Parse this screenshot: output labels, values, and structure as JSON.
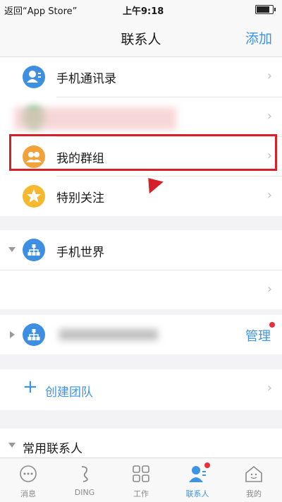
{
  "status_bar": {
    "back_label": "返回“App Store”",
    "time": "上午9:18"
  },
  "header": {
    "title": "联系人",
    "add_label": "添加"
  },
  "contacts": {
    "items": [
      {
        "label": "手机通讯录",
        "icon": "person-book-icon"
      },
      {
        "label": "",
        "icon": "blurred-icon"
      },
      {
        "label": "我的群组",
        "icon": "group-icon"
      },
      {
        "label": "特别关注",
        "icon": "star-icon"
      }
    ]
  },
  "org1": {
    "name": "手机世界"
  },
  "org2": {
    "manage_label": "管理"
  },
  "create_team": {
    "plus": "+",
    "label": "创建团队"
  },
  "frequent": {
    "label": "常用联系人"
  },
  "tabs": [
    {
      "label": "消息",
      "icon": "message-icon"
    },
    {
      "label": "DING",
      "icon": "ding-icon"
    },
    {
      "label": "工作",
      "icon": "work-grid-icon"
    },
    {
      "label": "联系人",
      "icon": "contacts-icon"
    },
    {
      "label": "我的",
      "icon": "home-profile-icon"
    }
  ],
  "colors": {
    "accent": "#3c94e4",
    "highlight": "#d8202a",
    "icon_blue": "#3d8fe2",
    "icon_orange": "#f2a23a",
    "icon_yellow": "#f5b82e"
  }
}
